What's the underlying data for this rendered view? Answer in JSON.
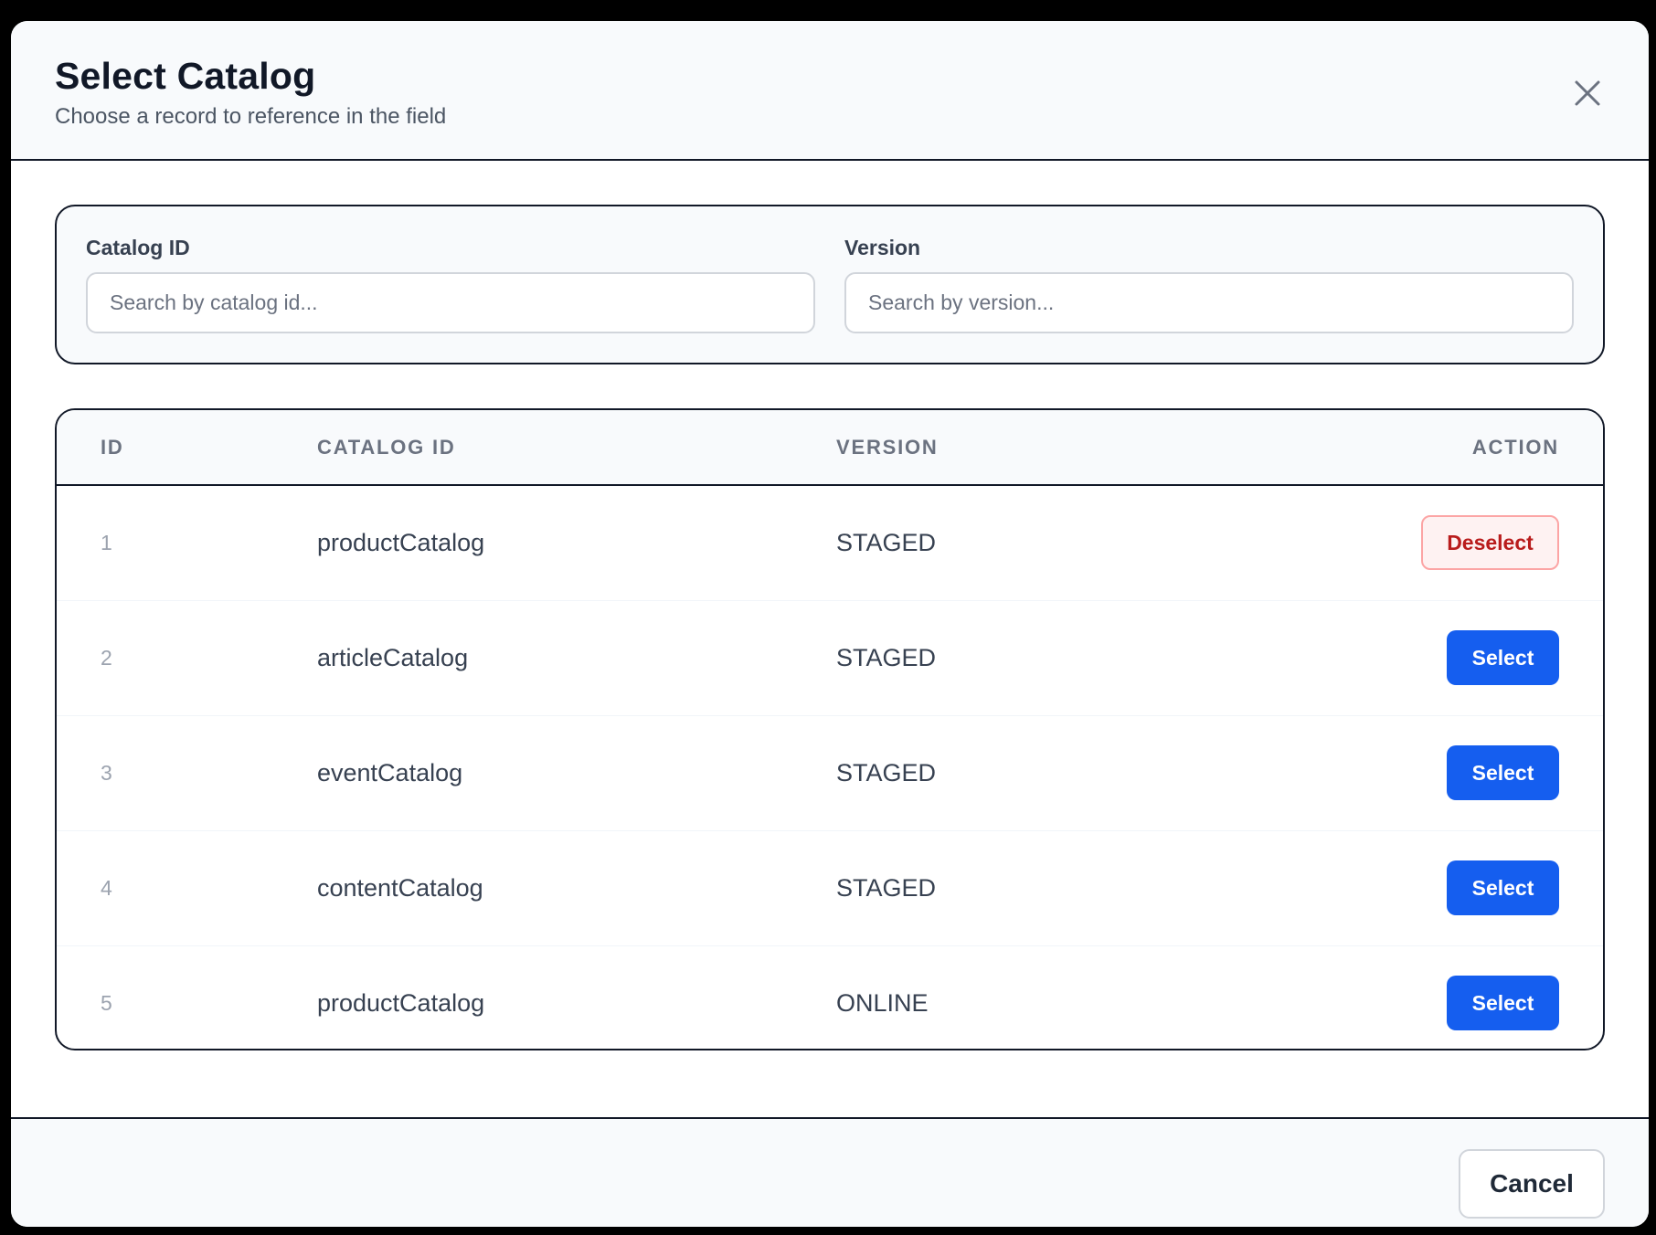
{
  "dialog": {
    "title": "Select Catalog",
    "subtitle": "Choose a record to reference in the field",
    "close_icon": "close-icon"
  },
  "filters": {
    "catalog_id": {
      "label": "Catalog ID",
      "placeholder": "Search by catalog id...",
      "value": ""
    },
    "version": {
      "label": "Version",
      "placeholder": "Search by version...",
      "value": ""
    }
  },
  "table": {
    "headers": {
      "id": "ID",
      "catalog_id": "CATALOG ID",
      "version": "VERSION",
      "action": "ACTION"
    },
    "rows": [
      {
        "id": "1",
        "catalog_id": "productCatalog",
        "version": "STAGED",
        "action": "Deselect"
      },
      {
        "id": "2",
        "catalog_id": "articleCatalog",
        "version": "STAGED",
        "action": "Select"
      },
      {
        "id": "3",
        "catalog_id": "eventCatalog",
        "version": "STAGED",
        "action": "Select"
      },
      {
        "id": "4",
        "catalog_id": "contentCatalog",
        "version": "STAGED",
        "action": "Select"
      },
      {
        "id": "5",
        "catalog_id": "productCatalog",
        "version": "ONLINE",
        "action": "Select"
      }
    ]
  },
  "footer": {
    "cancel_label": "Cancel"
  },
  "colors": {
    "primary": "#155eef",
    "danger_text": "#b91c1c",
    "danger_bg": "#fef2f2",
    "border_dark": "#111827"
  }
}
